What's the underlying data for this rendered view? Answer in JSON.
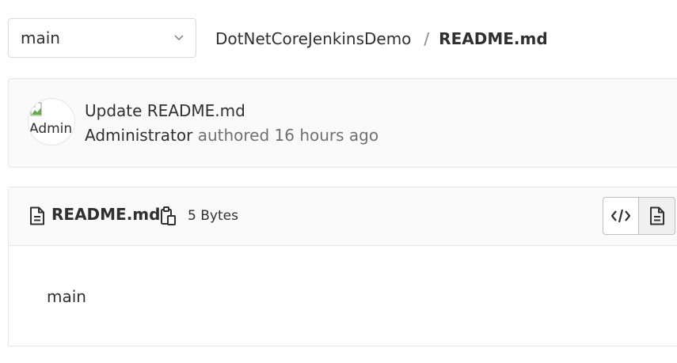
{
  "branch": {
    "selected": "main"
  },
  "breadcrumb": {
    "project": "DotNetCoreJenkinsDemo",
    "separator": "/",
    "file": "README.md"
  },
  "commit": {
    "title": "Update README.md",
    "author": "Administrator",
    "action": "authored",
    "time": "16 hours ago",
    "avatar_alt": "Admin"
  },
  "file": {
    "name": "README.md",
    "size": "5 Bytes",
    "content": "main",
    "icons": {
      "file": "file-text-icon",
      "copy": "copy-to-clipboard-icon",
      "source": "code-icon",
      "rendered": "document-icon"
    }
  }
}
